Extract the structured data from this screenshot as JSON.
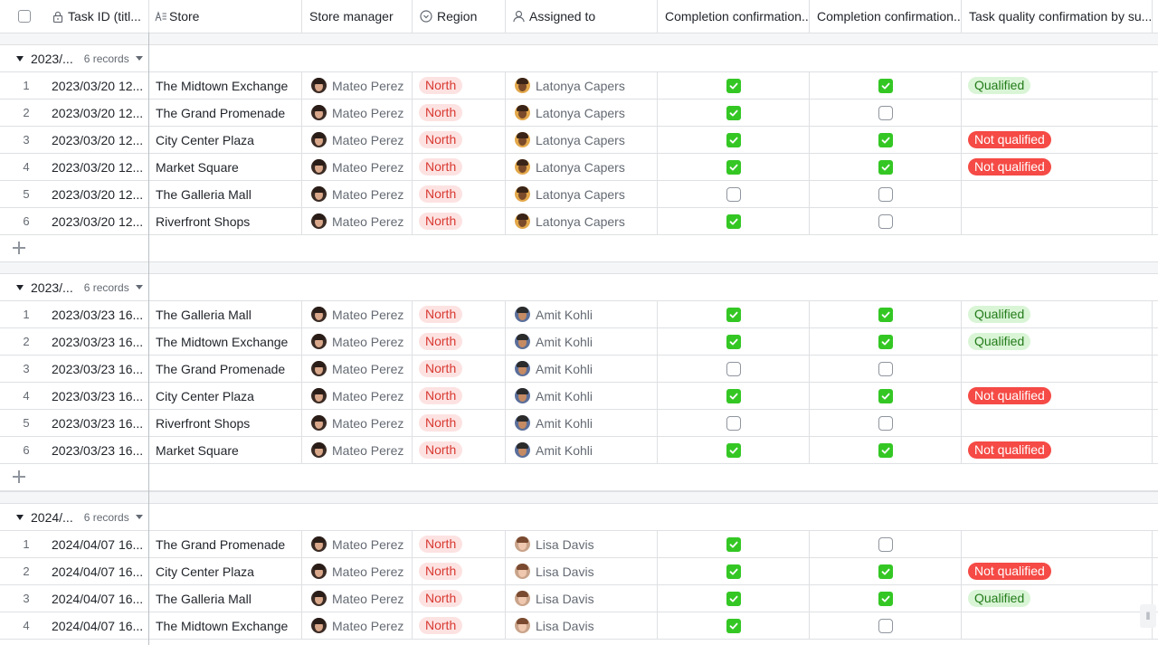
{
  "header": {
    "columns": [
      {
        "id": "task",
        "label": "Task ID (titl...",
        "icon": "lock-icon"
      },
      {
        "id": "store",
        "label": "Store",
        "icon": "text-field-icon"
      },
      {
        "id": "mgr",
        "label": "Store manager",
        "icon": ""
      },
      {
        "id": "region",
        "label": "Region",
        "icon": "single-select-icon"
      },
      {
        "id": "asg",
        "label": "Assigned to",
        "icon": "person-icon"
      },
      {
        "id": "cc1",
        "label": "Completion confirmation...",
        "icon": ""
      },
      {
        "id": "cc2",
        "label": "Completion confirmation...",
        "icon": ""
      },
      {
        "id": "tq",
        "label": "Task quality confirmation by su...",
        "icon": ""
      }
    ]
  },
  "colors": {
    "checked": "#34c724",
    "region_bg": "#fde2e2",
    "region_fg": "#d83931",
    "qualified_bg": "#d9f5d6",
    "not_qualified_bg": "#f54a45"
  },
  "groups": [
    {
      "label": "2023/...",
      "count": "6 records",
      "rows": [
        {
          "num": "1",
          "task": "2023/03/20 12...",
          "store": "The Midtown Exchange",
          "manager": "Mateo Perez",
          "region": "North",
          "assignee": "Latonya Capers",
          "cc1": true,
          "cc2": true,
          "quality": "Qualified"
        },
        {
          "num": "2",
          "task": "2023/03/20 12...",
          "store": "The Grand Promenade",
          "manager": "Mateo Perez",
          "region": "North",
          "assignee": "Latonya Capers",
          "cc1": true,
          "cc2": false,
          "quality": ""
        },
        {
          "num": "3",
          "task": "2023/03/20 12...",
          "store": "City Center Plaza",
          "manager": "Mateo Perez",
          "region": "North",
          "assignee": "Latonya Capers",
          "cc1": true,
          "cc2": true,
          "quality": "Not qualified"
        },
        {
          "num": "4",
          "task": "2023/03/20 12...",
          "store": "Market Square",
          "manager": "Mateo Perez",
          "region": "North",
          "assignee": "Latonya Capers",
          "cc1": true,
          "cc2": true,
          "quality": "Not qualified"
        },
        {
          "num": "5",
          "task": "2023/03/20 12...",
          "store": "The Galleria Mall",
          "manager": "Mateo Perez",
          "region": "North",
          "assignee": "Latonya Capers",
          "cc1": false,
          "cc2": false,
          "quality": ""
        },
        {
          "num": "6",
          "task": "2023/03/20 12...",
          "store": "Riverfront Shops",
          "manager": "Mateo Perez",
          "region": "North",
          "assignee": "Latonya Capers",
          "cc1": true,
          "cc2": false,
          "quality": ""
        }
      ]
    },
    {
      "label": "2023/...",
      "count": "6 records",
      "rows": [
        {
          "num": "1",
          "task": "2023/03/23 16...",
          "store": "The Galleria Mall",
          "manager": "Mateo Perez",
          "region": "North",
          "assignee": "Amit Kohli",
          "cc1": true,
          "cc2": true,
          "quality": "Qualified"
        },
        {
          "num": "2",
          "task": "2023/03/23 16...",
          "store": "The Midtown Exchange",
          "manager": "Mateo Perez",
          "region": "North",
          "assignee": "Amit Kohli",
          "cc1": true,
          "cc2": true,
          "quality": "Qualified"
        },
        {
          "num": "3",
          "task": "2023/03/23 16...",
          "store": "The Grand Promenade",
          "manager": "Mateo Perez",
          "region": "North",
          "assignee": "Amit Kohli",
          "cc1": false,
          "cc2": false,
          "quality": ""
        },
        {
          "num": "4",
          "task": "2023/03/23 16...",
          "store": "City Center Plaza",
          "manager": "Mateo Perez",
          "region": "North",
          "assignee": "Amit Kohli",
          "cc1": true,
          "cc2": true,
          "quality": "Not qualified"
        },
        {
          "num": "5",
          "task": "2023/03/23 16...",
          "store": "Riverfront Shops",
          "manager": "Mateo Perez",
          "region": "North",
          "assignee": "Amit Kohli",
          "cc1": false,
          "cc2": false,
          "quality": ""
        },
        {
          "num": "6",
          "task": "2023/03/23 16...",
          "store": "Market Square",
          "manager": "Mateo Perez",
          "region": "North",
          "assignee": "Amit Kohli",
          "cc1": true,
          "cc2": true,
          "quality": "Not qualified"
        }
      ]
    },
    {
      "label": "2024/...",
      "count": "6 records",
      "rows": [
        {
          "num": "1",
          "task": "2024/04/07 16...",
          "store": "The Grand Promenade",
          "manager": "Mateo Perez",
          "region": "North",
          "assignee": "Lisa Davis",
          "cc1": true,
          "cc2": false,
          "quality": ""
        },
        {
          "num": "2",
          "task": "2024/04/07 16...",
          "store": "City Center Plaza",
          "manager": "Mateo Perez",
          "region": "North",
          "assignee": "Lisa Davis",
          "cc1": true,
          "cc2": true,
          "quality": "Not qualified"
        },
        {
          "num": "3",
          "task": "2024/04/07 16...",
          "store": "The Galleria Mall",
          "manager": "Mateo Perez",
          "region": "North",
          "assignee": "Lisa Davis",
          "cc1": true,
          "cc2": true,
          "quality": "Qualified"
        },
        {
          "num": "4",
          "task": "2024/04/07 16...",
          "store": "The Midtown Exchange",
          "manager": "Mateo Perez",
          "region": "North",
          "assignee": "Lisa Davis",
          "cc1": true,
          "cc2": false,
          "quality": ""
        }
      ]
    }
  ]
}
